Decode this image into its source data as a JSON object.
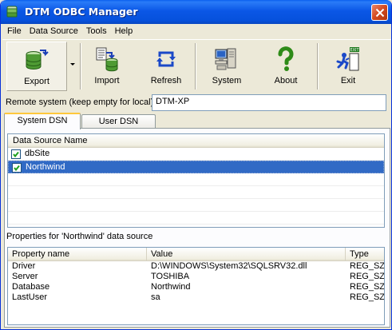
{
  "window": {
    "title": "DTM ODBC Manager"
  },
  "menu": [
    "File",
    "Data Source",
    "Tools",
    "Help"
  ],
  "toolbar": {
    "export": "Export",
    "import": "Import",
    "refresh": "Refresh",
    "system": "System",
    "about": "About",
    "exit": "Exit",
    "exit_sign": "EXIT"
  },
  "remote": {
    "label": "Remote system (keep empty for local)",
    "value": "DTM-XP"
  },
  "tabs": {
    "system_dsn": "System DSN",
    "user_dsn": "User DSN"
  },
  "dsn_list": {
    "header": "Data Source Name",
    "items": [
      {
        "name": "dbSite",
        "checked": true,
        "selected": false
      },
      {
        "name": "Northwind",
        "checked": true,
        "selected": true
      }
    ]
  },
  "properties": {
    "label": "Properties for 'Northwind' data source",
    "columns": [
      "Property name",
      "Value",
      "Type"
    ],
    "rows": [
      [
        "Driver",
        "D:\\WINDOWS\\System32\\SQLSRV32.dll",
        "REG_SZ"
      ],
      [
        "Server",
        "TOSHIBA",
        "REG_SZ"
      ],
      [
        "Database",
        "Northwind",
        "REG_SZ"
      ],
      [
        "LastUser",
        "sa",
        "REG_SZ"
      ]
    ]
  },
  "colors": {
    "title_bar": "#0A5FEF",
    "selection": "#316AC5",
    "tab_highlight": "#FFC83C",
    "close_button": "#D2491F"
  }
}
